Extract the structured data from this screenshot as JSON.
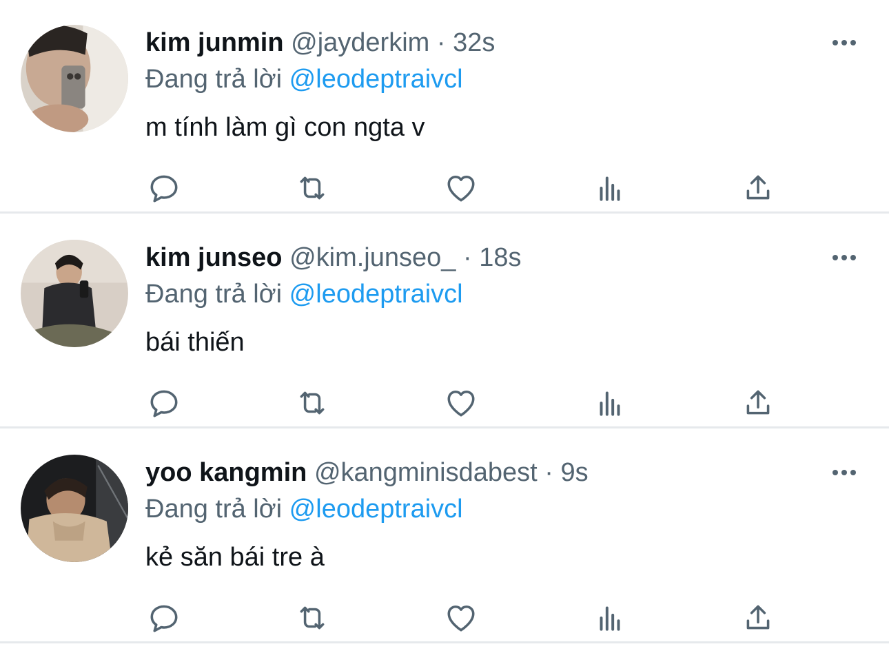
{
  "tweets": [
    {
      "display_name": "kim junmin",
      "handle": "@jayderkim",
      "separator": "·",
      "time": "32s",
      "reply_prefix": "Đang trả lời",
      "reply_to": "@leodeptraivcl",
      "text": "m tính làm gì con ngta v"
    },
    {
      "display_name": "kim junseo",
      "handle": "@kim.junseo_",
      "separator": "·",
      "time": "18s",
      "reply_prefix": "Đang trả lời",
      "reply_to": "@leodeptraivcl",
      "text": "bái thiến"
    },
    {
      "display_name": "yoo kangmin",
      "handle": "@kangminisdabest",
      "separator": "·",
      "time": "9s",
      "reply_prefix": "Đang trả lời",
      "reply_to": "@leodeptraivcl",
      "text": "kẻ săn bái tre à"
    }
  ],
  "icons": {
    "reply": "reply-icon",
    "retweet": "retweet-icon",
    "like": "heart-icon",
    "views": "analytics-icon",
    "share": "share-icon",
    "more": "more-icon"
  },
  "colors": {
    "text": "#0f1419",
    "secondary": "#536471",
    "mention": "#1d9bf0",
    "divider": "#e6e9ec"
  }
}
